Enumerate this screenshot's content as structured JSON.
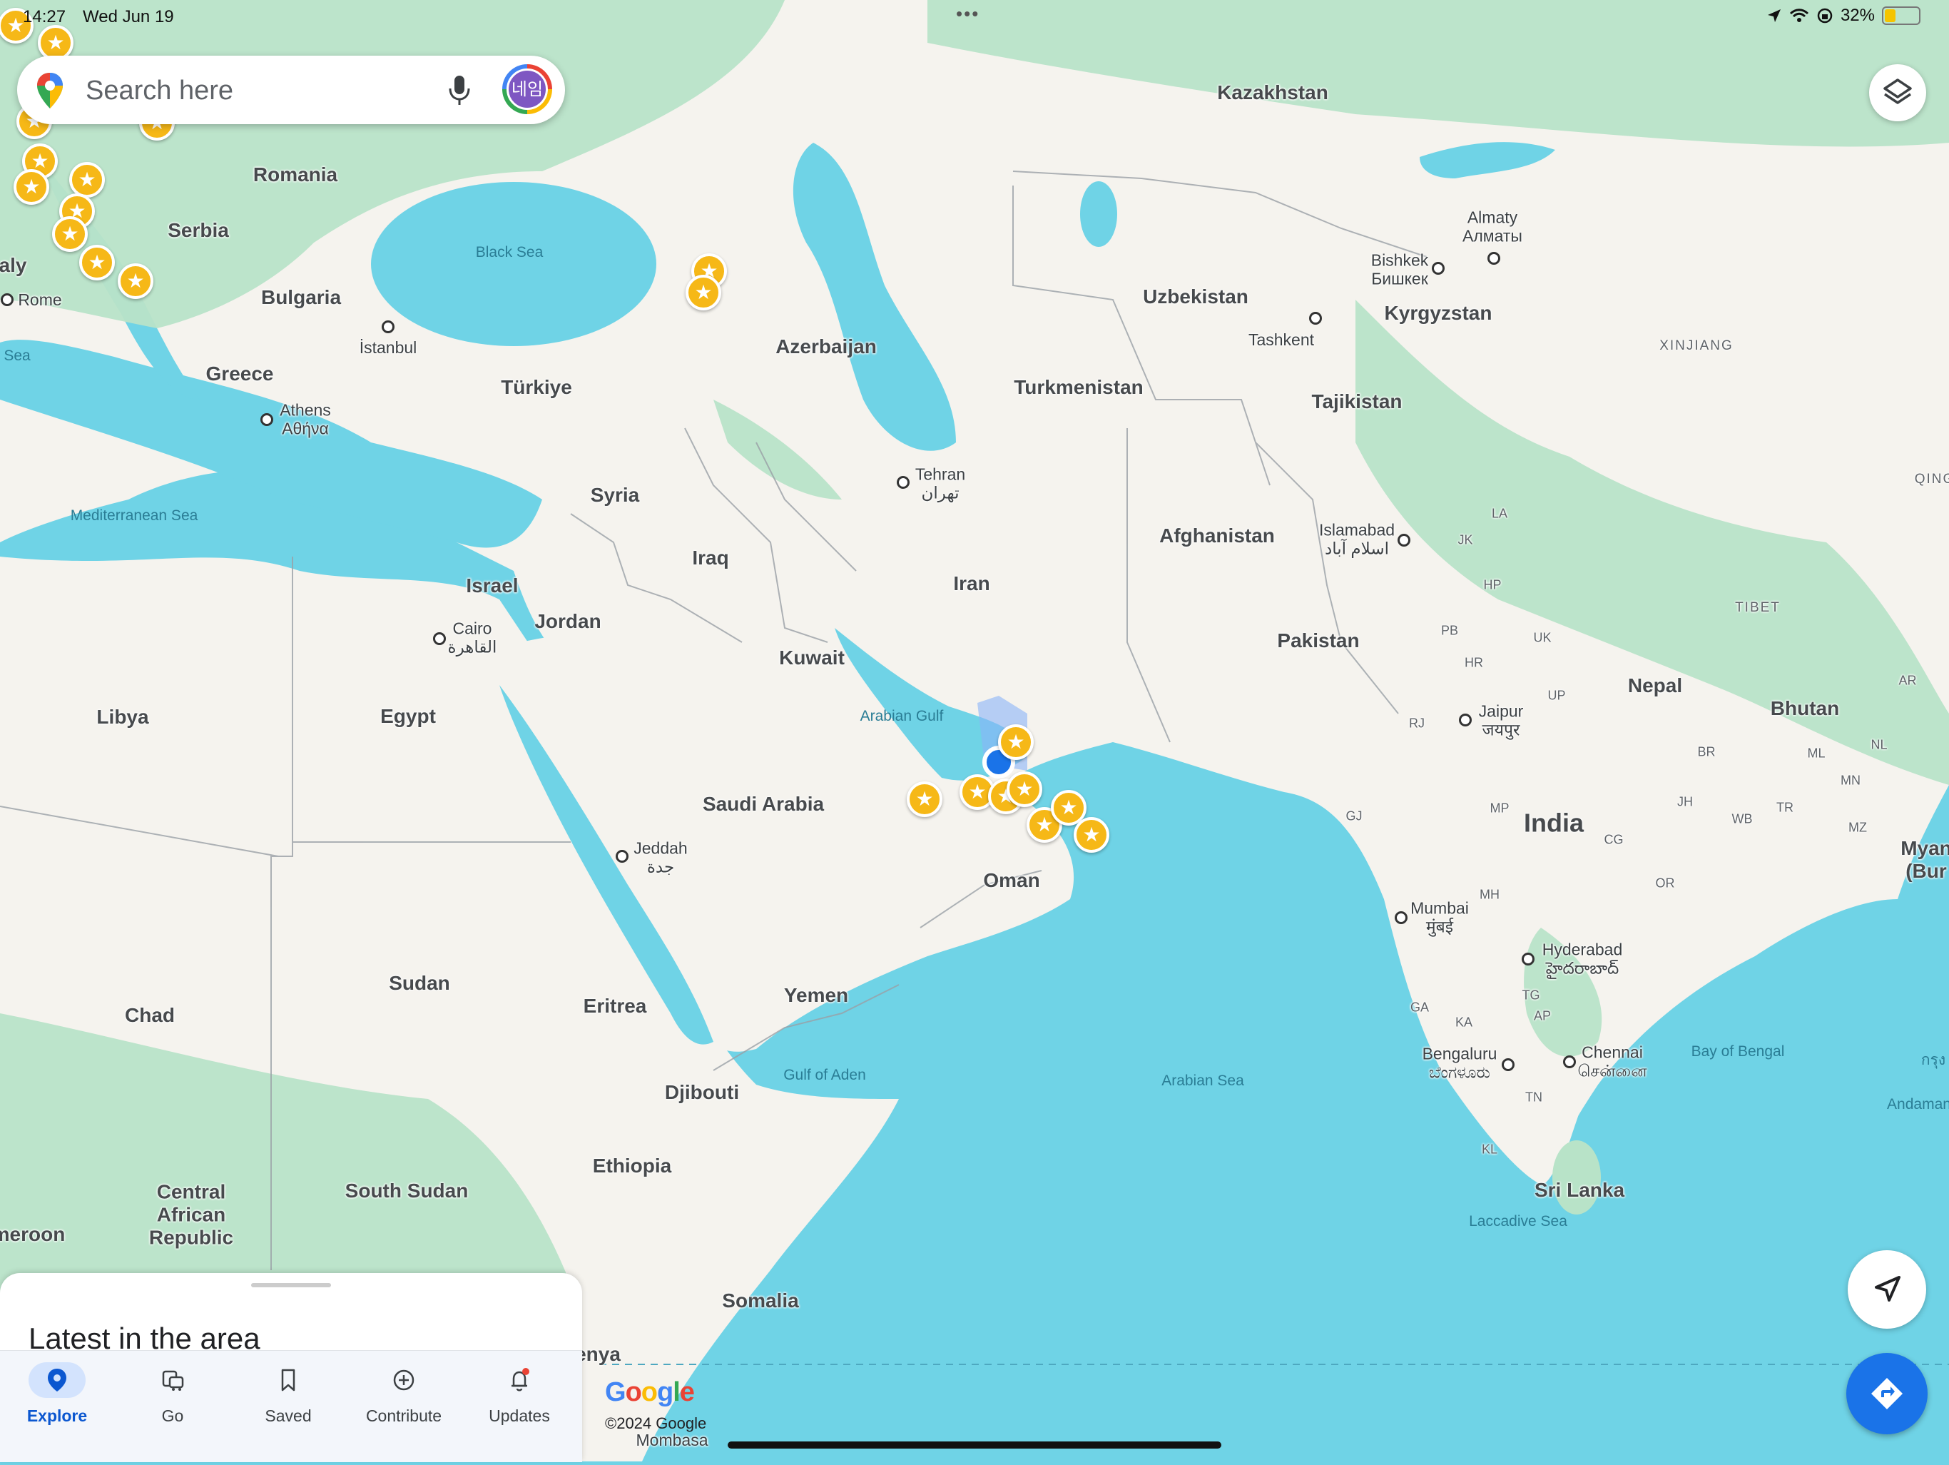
{
  "status_bar": {
    "time": "14:27",
    "date": "Wed Jun 19",
    "battery_percent": "32%",
    "battery_level": 0.32
  },
  "search": {
    "placeholder": "Search here",
    "avatar_text": "네임"
  },
  "map": {
    "countries": [
      "Kazakhstan",
      "Romania",
      "Serbia",
      "Bulgaria",
      "Greece",
      "Türkiye",
      "Azerbaijan",
      "Uzbekistan",
      "Kyrgyzstan",
      "Turkmenistan",
      "Tajikistan",
      "Syria",
      "Iraq",
      "Iran",
      "Afghanistan",
      "Israel",
      "Jordan",
      "Kuwait",
      "Pakistan",
      "Libya",
      "Egypt",
      "Saudi Arabia",
      "Nepal",
      "Bhutan",
      "India",
      "Oman",
      "Yemen",
      "Sudan",
      "Chad",
      "Eritrea",
      "Djibouti",
      "Ethiopia",
      "Central African Republic",
      "South Sudan",
      "Somalia",
      "Sri Lanka",
      "Myan (Bur",
      "aly",
      "meroon",
      "enya"
    ],
    "cities": [
      {
        "name": "Rome"
      },
      {
        "name": "İstanbul"
      },
      {
        "name": "Athens",
        "alt": "Αθήνα"
      },
      {
        "name": "Tehran",
        "alt": "تهران"
      },
      {
        "name": "Almaty",
        "alt": "Алматы"
      },
      {
        "name": "Bishkek",
        "alt": "Бишкек"
      },
      {
        "name": "Tashkent"
      },
      {
        "name": "Islamabad",
        "alt": "اسلام آباد"
      },
      {
        "name": "Cairo",
        "alt": "القاهرة"
      },
      {
        "name": "Jaipur",
        "alt": "जयपुर"
      },
      {
        "name": "Jeddah",
        "alt": "جدة"
      },
      {
        "name": "Mumbai",
        "alt": "मुंबई"
      },
      {
        "name": "Hyderabad",
        "alt": "హైదరాబాద్"
      },
      {
        "name": "Chennai",
        "alt": "சென்னை"
      },
      {
        "name": "Bengaluru",
        "alt": "ಬೆಂಗಳೂರು"
      },
      {
        "name": "Mombasa"
      }
    ],
    "seas": [
      "Black Sea",
      "Mediterranean Sea",
      "Arabian Gulf",
      "Gulf of Aden",
      "Arabian Sea",
      "Bay of Bengal",
      "Laccadive Sea",
      "Andaman",
      "Sea",
      "กรุง"
    ],
    "regions": [
      "XINJIANG",
      "TIBET",
      "QING"
    ],
    "state_codes": [
      "LA",
      "JK",
      "HP",
      "PB",
      "UK",
      "HR",
      "UP",
      "RJ",
      "GJ",
      "MP",
      "BR",
      "JH",
      "WB",
      "CG",
      "OR",
      "MH",
      "GA",
      "KA",
      "TG",
      "AP",
      "TN",
      "KL",
      "ML",
      "MN",
      "MZ",
      "NL",
      "AR",
      "TR"
    ]
  },
  "panel": {
    "title": "Latest in the area"
  },
  "nav": [
    {
      "label": "Explore",
      "icon": "explore-pin-icon",
      "active": true
    },
    {
      "label": "Go",
      "icon": "commute-icon",
      "active": false
    },
    {
      "label": "Saved",
      "icon": "bookmark-icon",
      "active": false
    },
    {
      "label": "Contribute",
      "icon": "add-circle-icon",
      "active": false
    },
    {
      "label": "Updates",
      "icon": "bell-icon",
      "active": false,
      "badge": true
    }
  ],
  "attribution": {
    "logo": "Google",
    "copyright": "©2024 Google"
  },
  "colors": {
    "water": "#6fd3e6",
    "land": "#f5f3ee",
    "vegetation": "#b8e3c8",
    "pin": "#f6b817",
    "accent": "#1a73e8"
  }
}
